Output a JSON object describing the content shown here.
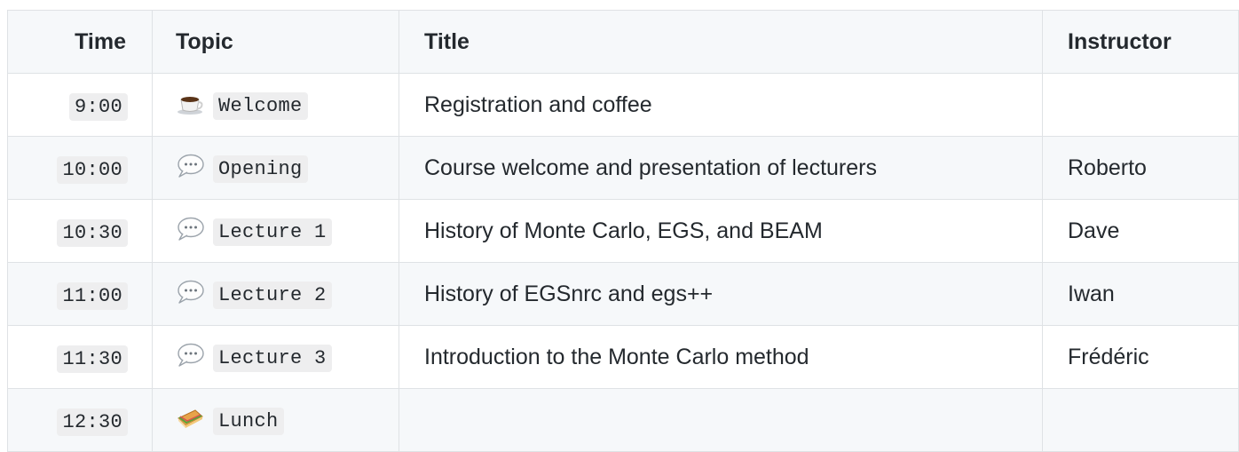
{
  "table": {
    "headers": {
      "time": "Time",
      "topic": "Topic",
      "title": "Title",
      "instructor": "Instructor"
    },
    "rows": [
      {
        "time": "9:00",
        "icon": "coffee-icon",
        "topic": "Welcome",
        "title": "Registration and coffee",
        "instructor": ""
      },
      {
        "time": "10:00",
        "icon": "speech-bubble-icon",
        "topic": "Opening",
        "title": "Course welcome and presentation of lecturers",
        "instructor": "Roberto"
      },
      {
        "time": "10:30",
        "icon": "speech-bubble-icon",
        "topic": "Lecture 1",
        "title": "History of Monte Carlo, EGS, and BEAM",
        "instructor": "Dave"
      },
      {
        "time": "11:00",
        "icon": "speech-bubble-icon",
        "topic": "Lecture 2",
        "title": "History of EGSnrc and egs++",
        "instructor": "Iwan"
      },
      {
        "time": "11:30",
        "icon": "speech-bubble-icon",
        "topic": "Lecture 3",
        "title": "Introduction to the Monte Carlo method",
        "instructor": "Frédéric"
      },
      {
        "time": "12:30",
        "icon": "sandwich-icon",
        "topic": "Lunch",
        "title": "",
        "instructor": ""
      }
    ]
  }
}
